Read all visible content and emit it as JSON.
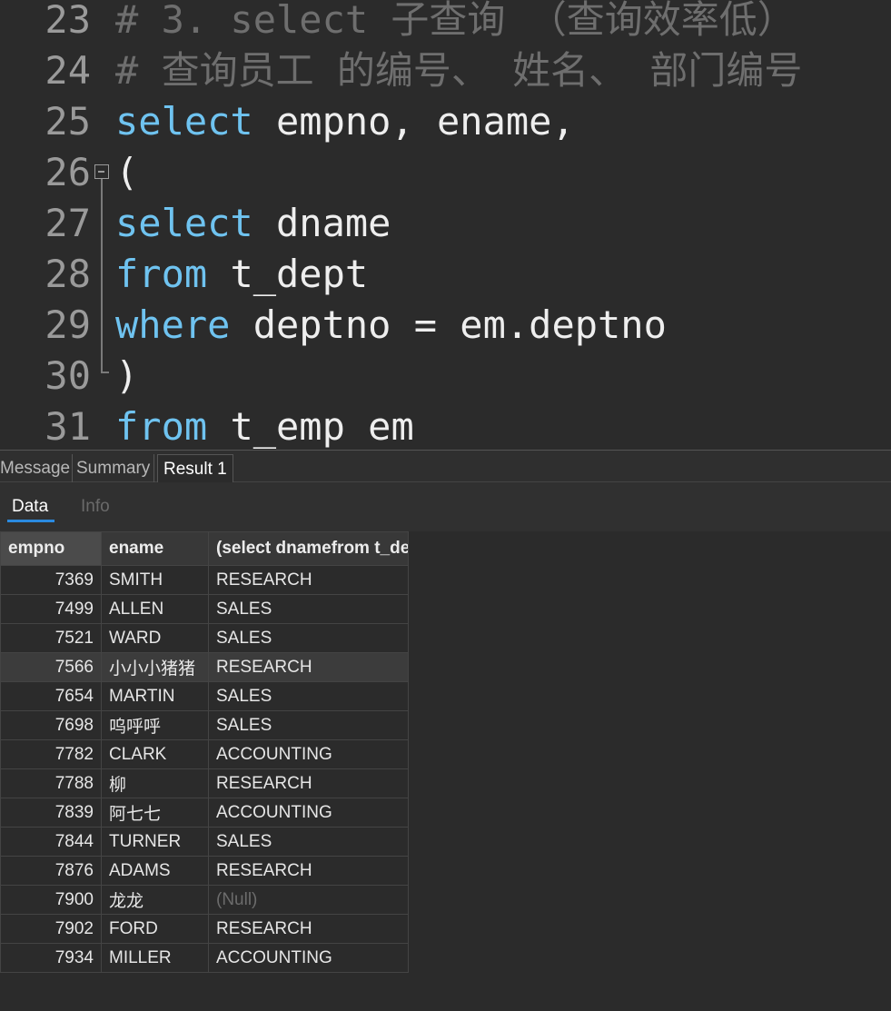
{
  "editor": {
    "lines": [
      {
        "num": "23",
        "segments": [
          {
            "text": "# 3. select 子查询 （查询效率低）",
            "cls": "comment"
          }
        ]
      },
      {
        "num": "24",
        "segments": [
          {
            "text": "# 查询员工 的编号、 姓名、 部门编号",
            "cls": "comment"
          }
        ]
      },
      {
        "num": "25",
        "segments": [
          {
            "text": "select",
            "cls": "kw"
          },
          {
            "text": " empno, ename,",
            "cls": ""
          }
        ]
      },
      {
        "num": "26",
        "segments": [
          {
            "text": "(",
            "cls": ""
          }
        ]
      },
      {
        "num": "27",
        "segments": [
          {
            "text": "select",
            "cls": "kw"
          },
          {
            "text": " dname",
            "cls": ""
          }
        ]
      },
      {
        "num": "28",
        "segments": [
          {
            "text": "from",
            "cls": "kw"
          },
          {
            "text": " t_dept",
            "cls": ""
          }
        ]
      },
      {
        "num": "29",
        "segments": [
          {
            "text": "where",
            "cls": "kw"
          },
          {
            "text": " deptno = em.deptno",
            "cls": ""
          }
        ]
      },
      {
        "num": "30",
        "segments": [
          {
            "text": ")",
            "cls": ""
          }
        ]
      },
      {
        "num": "31",
        "segments": [
          {
            "text": "from",
            "cls": "kw"
          },
          {
            "text": " t_emp em",
            "cls": ""
          }
        ]
      }
    ]
  },
  "result_tabs": {
    "message": "Message",
    "summary": "Summary",
    "result1": "Result 1"
  },
  "sub_tabs": {
    "data": "Data",
    "info": "Info"
  },
  "grid": {
    "columns": [
      "empno",
      "ename",
      "(select dnamefrom t_dept"
    ],
    "rows": [
      [
        "7369",
        "SMITH",
        "RESEARCH"
      ],
      [
        "7499",
        "ALLEN",
        "SALES"
      ],
      [
        "7521",
        "WARD",
        "SALES"
      ],
      [
        "7566",
        "小小小猪猪",
        "RESEARCH"
      ],
      [
        "7654",
        "MARTIN",
        "SALES"
      ],
      [
        "7698",
        "呜呼呼",
        "SALES"
      ],
      [
        "7782",
        "CLARK",
        "ACCOUNTING"
      ],
      [
        "7788",
        "柳",
        "RESEARCH"
      ],
      [
        "7839",
        "阿七七",
        "ACCOUNTING"
      ],
      [
        "7844",
        "TURNER",
        "SALES"
      ],
      [
        "7876",
        "ADAMS",
        "RESEARCH"
      ],
      [
        "7900",
        "龙龙",
        "(Null)"
      ],
      [
        "7902",
        "FORD",
        "RESEARCH"
      ],
      [
        "7934",
        "MILLER",
        "ACCOUNTING"
      ]
    ],
    "highlighted_row": 3
  },
  "colors": {
    "keyword": "#6fc3f0",
    "comment": "#6e6e6e",
    "accent": "#2a8ae0"
  }
}
